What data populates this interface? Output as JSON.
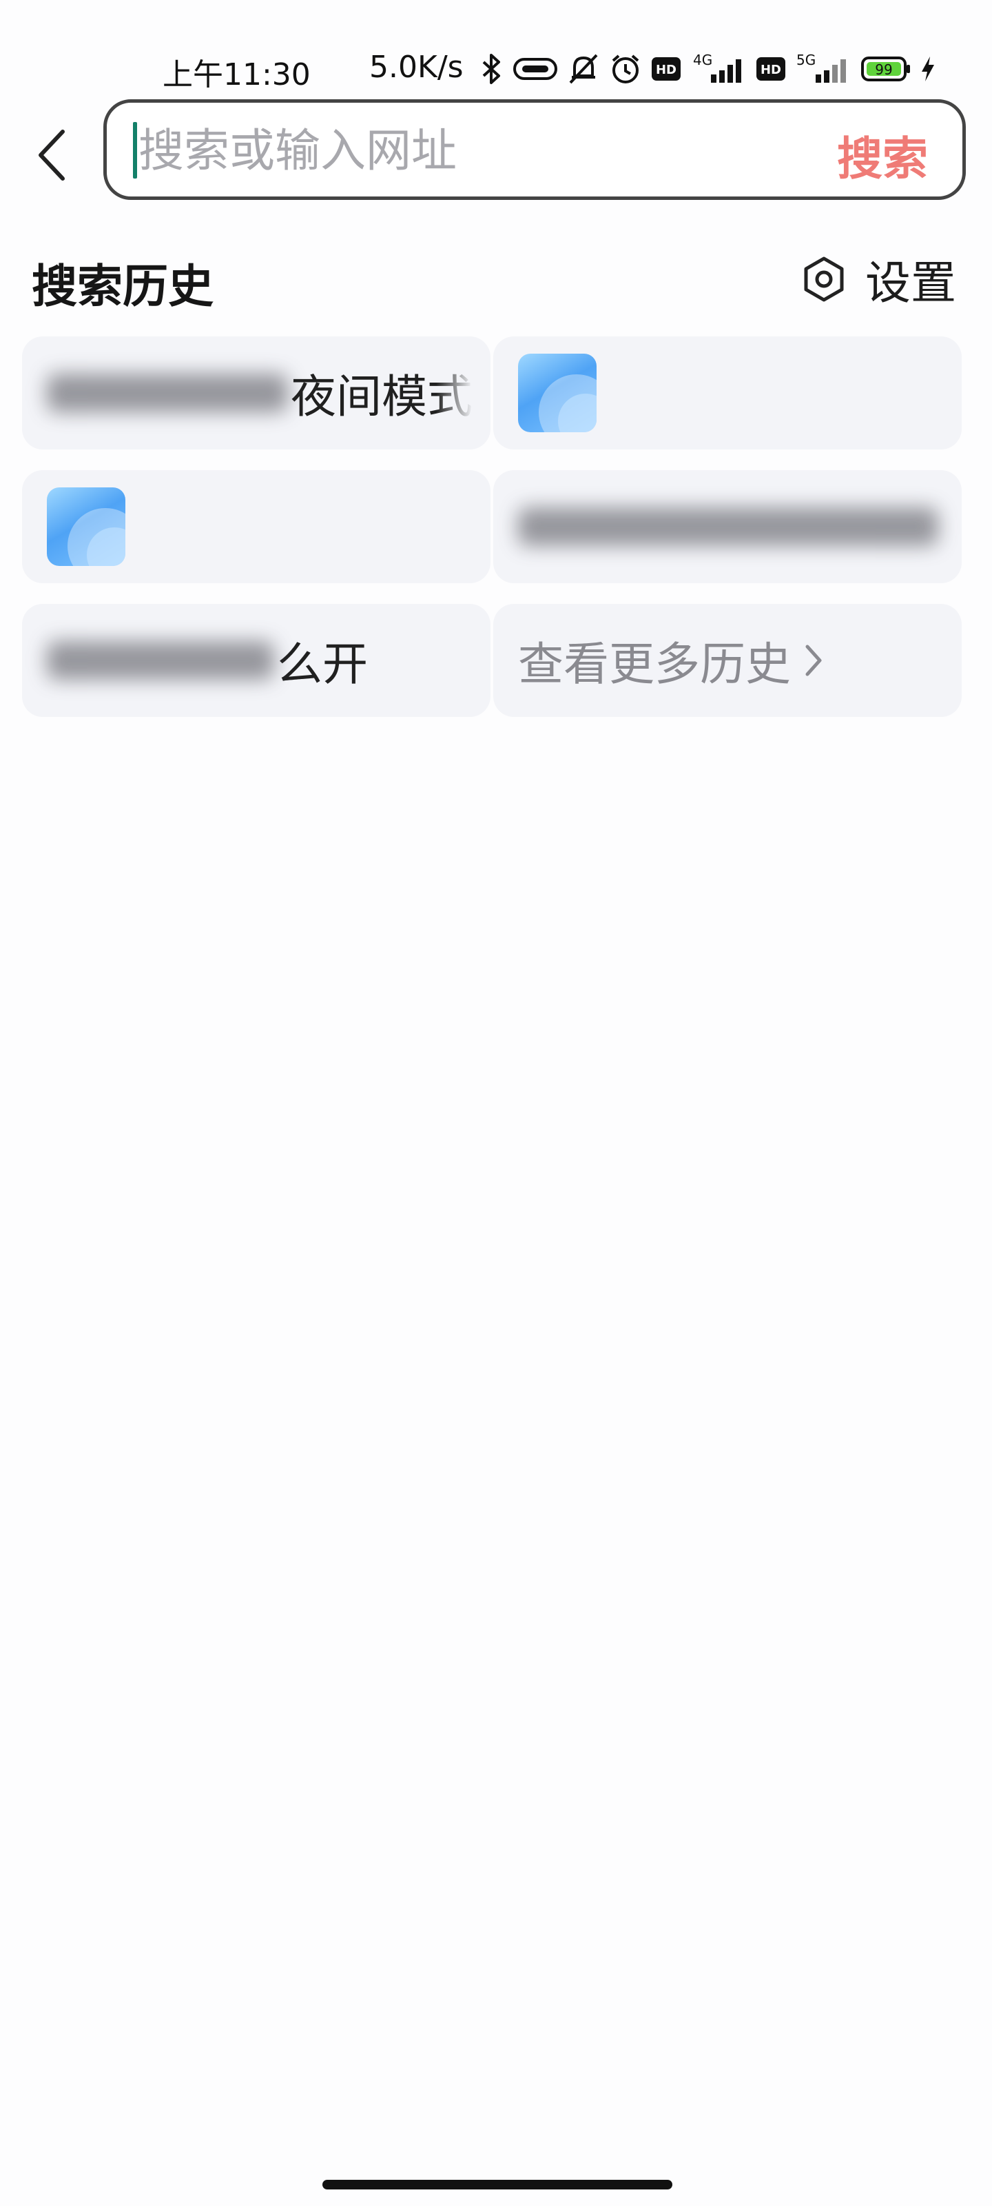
{
  "status_bar": {
    "time": "上午11:30",
    "speed": "5.0K/s",
    "icons": [
      "bluetooth-icon",
      "link-icon",
      "mute-bell-icon",
      "alarm-icon",
      "hd-icon",
      "signal-4g-icon",
      "hd-icon",
      "signal-5g-icon",
      "battery-icon",
      "charging-icon"
    ],
    "net_4g": "4G",
    "net_5g": "5G",
    "hd": "HD",
    "battery_level": "99",
    "battery_color": "#5fd33b"
  },
  "search": {
    "placeholder": "搜索或输入网址",
    "value": "",
    "submit_label": "搜索",
    "accent_color": "#ef7b76"
  },
  "history": {
    "title": "搜索历史",
    "settings_label": "设置",
    "items": [
      {
        "text": "夜间模式"
      },
      {
        "text": ""
      },
      {
        "text": ""
      },
      {
        "text": ""
      },
      {
        "text": "么开"
      },
      {
        "text": "查看更多历史"
      }
    ]
  }
}
